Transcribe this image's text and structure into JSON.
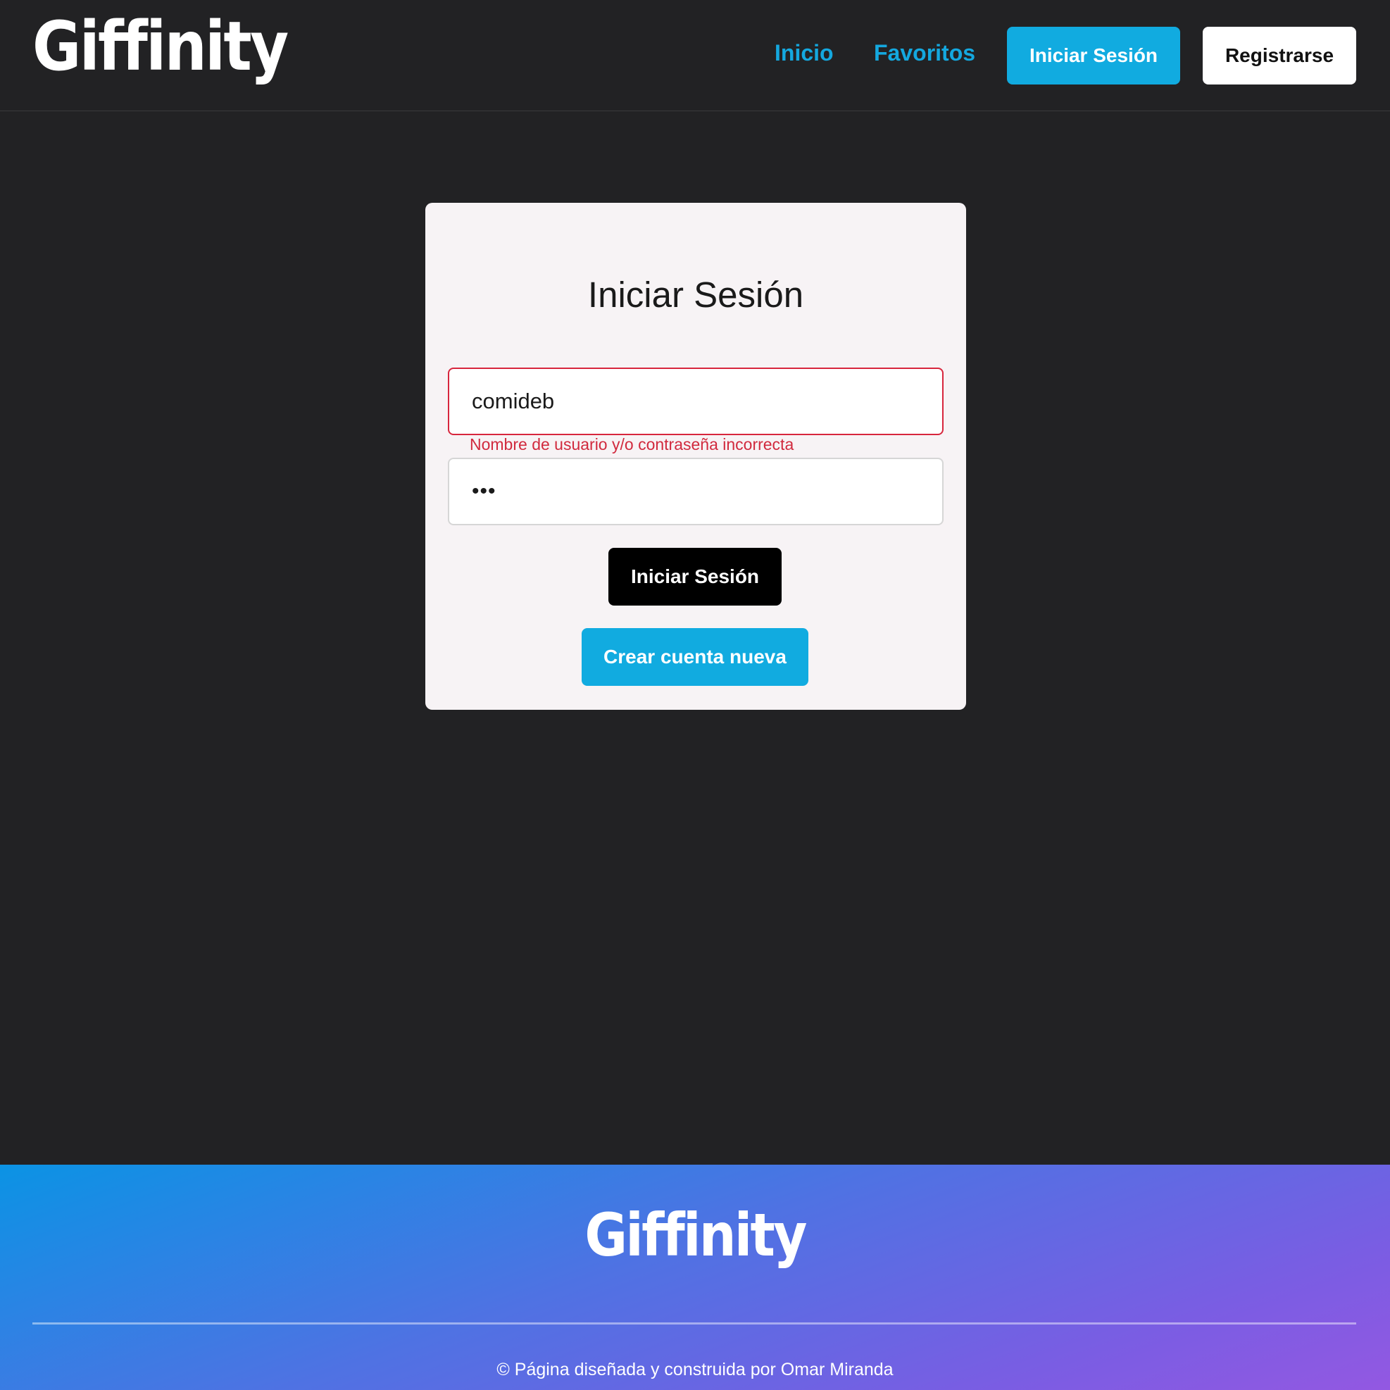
{
  "header": {
    "logo": "Giffinity",
    "nav": {
      "inicio": "Inicio",
      "favoritos": "Favoritos"
    },
    "login_button": "Iniciar Sesión",
    "register_button": "Registrarse"
  },
  "login_form": {
    "title": "Iniciar Sesión",
    "username_value": "comideb",
    "error_message": "Nombre de usuario y/o contraseña incorrecta",
    "password_masked": "•••",
    "submit_button": "Iniciar Sesión",
    "create_account_button": "Crear cuenta nueva"
  },
  "footer": {
    "logo": "Giffinity",
    "copyright": "© Página diseñada y construida por Omar Miranda"
  },
  "colors": {
    "background": "#222224",
    "accent": "#11abe0",
    "error": "#d12a3e",
    "card": "#f7f3f5",
    "footer_gradient_start": "#0b93e4",
    "footer_gradient_end": "#9358e2"
  }
}
